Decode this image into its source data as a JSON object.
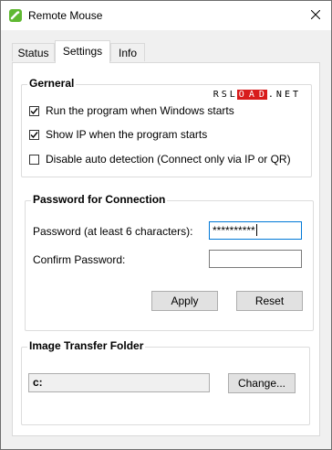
{
  "window": {
    "title": "Remote Mouse",
    "app_icon": "remote-mouse-app-icon",
    "close_icon": "close-icon"
  },
  "tabs": [
    {
      "label": "Status",
      "active": false
    },
    {
      "label": "Settings",
      "active": true
    },
    {
      "label": "Info",
      "active": false
    }
  ],
  "general": {
    "title": "Gerneral",
    "watermark": [
      "R",
      "S",
      "L",
      "O",
      "A",
      "D",
      ".",
      "N",
      "E",
      "T"
    ],
    "options": [
      {
        "label": "Run the program when Windows starts",
        "checked": true
      },
      {
        "label": "Show IP when the program starts",
        "checked": true
      },
      {
        "label": "Disable auto detection (Connect only via IP or QR)",
        "checked": false
      }
    ]
  },
  "password": {
    "title": "Password for Connection",
    "password_label": "Password (at least 6 characters):",
    "password_value": "**********",
    "confirm_label": "Confirm Password:",
    "confirm_value": "",
    "apply_label": "Apply",
    "reset_label": "Reset"
  },
  "image_folder": {
    "title": "Image Transfer Folder",
    "path": "c:",
    "change_label": "Change..."
  },
  "colors": {
    "watermark_red": "#d81b1b",
    "focus_border": "#0078d7",
    "app_icon_green": "#5fb832"
  }
}
